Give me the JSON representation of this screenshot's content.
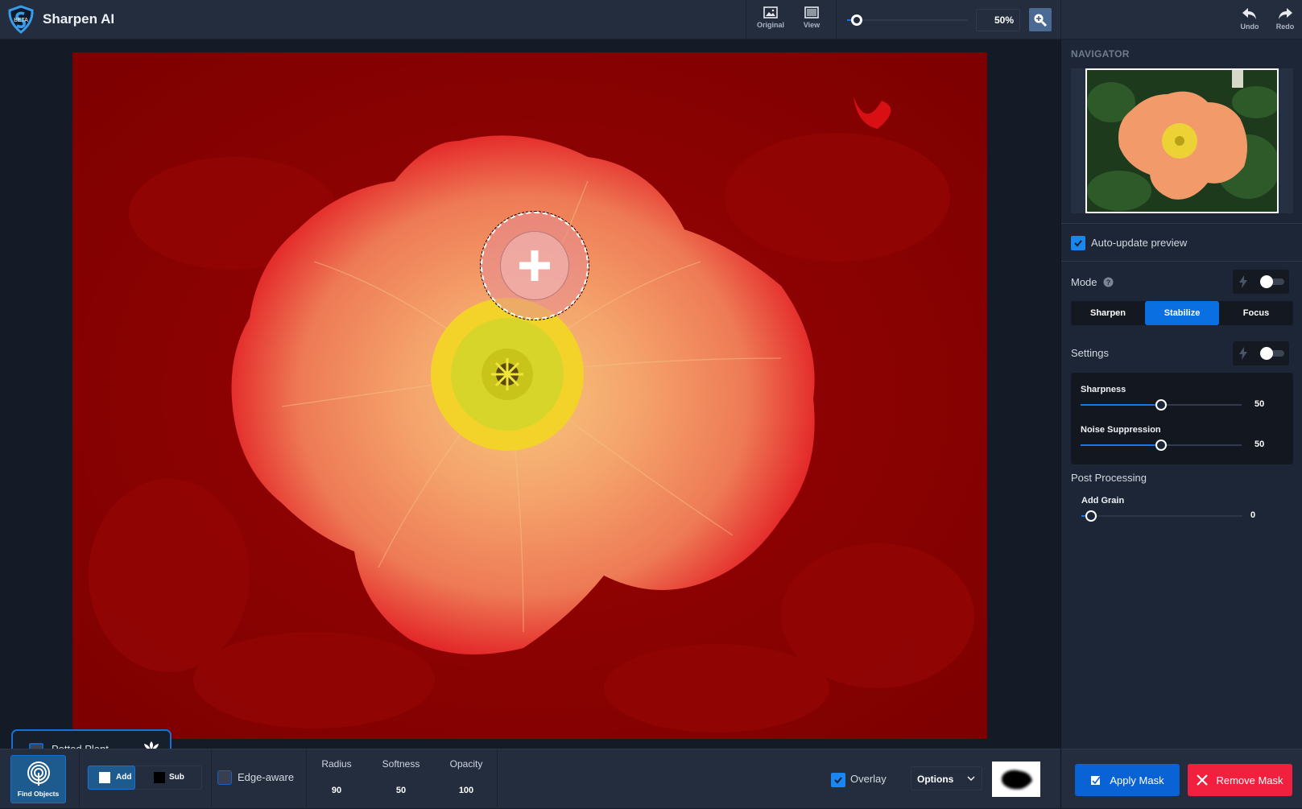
{
  "app": {
    "title": "Sharpen AI",
    "badge": "BETA"
  },
  "toolbar": {
    "original_label": "Original",
    "view_label": "View",
    "zoom_value": "50%",
    "zoom_slider_percent": 5,
    "undo_label": "Undo",
    "redo_label": "Redo"
  },
  "canvas": {
    "detected_object": {
      "label": "Potted Plant",
      "checked": false
    },
    "brush_mode": "add"
  },
  "navigator": {
    "title": "NAVIGATOR"
  },
  "preview": {
    "auto_update_label": "Auto-update preview",
    "auto_update_checked": true
  },
  "mode": {
    "label": "Mode",
    "options": [
      "Sharpen",
      "Stabilize",
      "Focus"
    ],
    "selected": "Stabilize",
    "auto_toggle": false
  },
  "settings": {
    "label": "Settings",
    "auto_toggle": false,
    "sliders": [
      {
        "label": "Sharpness",
        "value": "50",
        "percent": 50
      },
      {
        "label": "Noise Suppression",
        "value": "50",
        "percent": 50
      }
    ]
  },
  "post_processing": {
    "label": "Post Processing",
    "sliders": [
      {
        "label": "Add Grain",
        "value": "0",
        "percent": 0
      }
    ]
  },
  "mask_toolbar": {
    "find_objects_label": "Find Objects",
    "add_label": "Add",
    "sub_label": "Sub",
    "edge_aware_label": "Edge-aware",
    "edge_aware_checked": false,
    "params": [
      {
        "label": "Radius",
        "value": "90"
      },
      {
        "label": "Softness",
        "value": "50"
      },
      {
        "label": "Opacity",
        "value": "100"
      }
    ],
    "overlay_label": "Overlay",
    "overlay_checked": true,
    "options_label": "Options"
  },
  "actions": {
    "apply_label": "Apply Mask",
    "remove_label": "Remove Mask"
  },
  "colors": {
    "accent": "#0a6fe0",
    "danger": "#f0203e",
    "overlay": "#8a0000"
  }
}
